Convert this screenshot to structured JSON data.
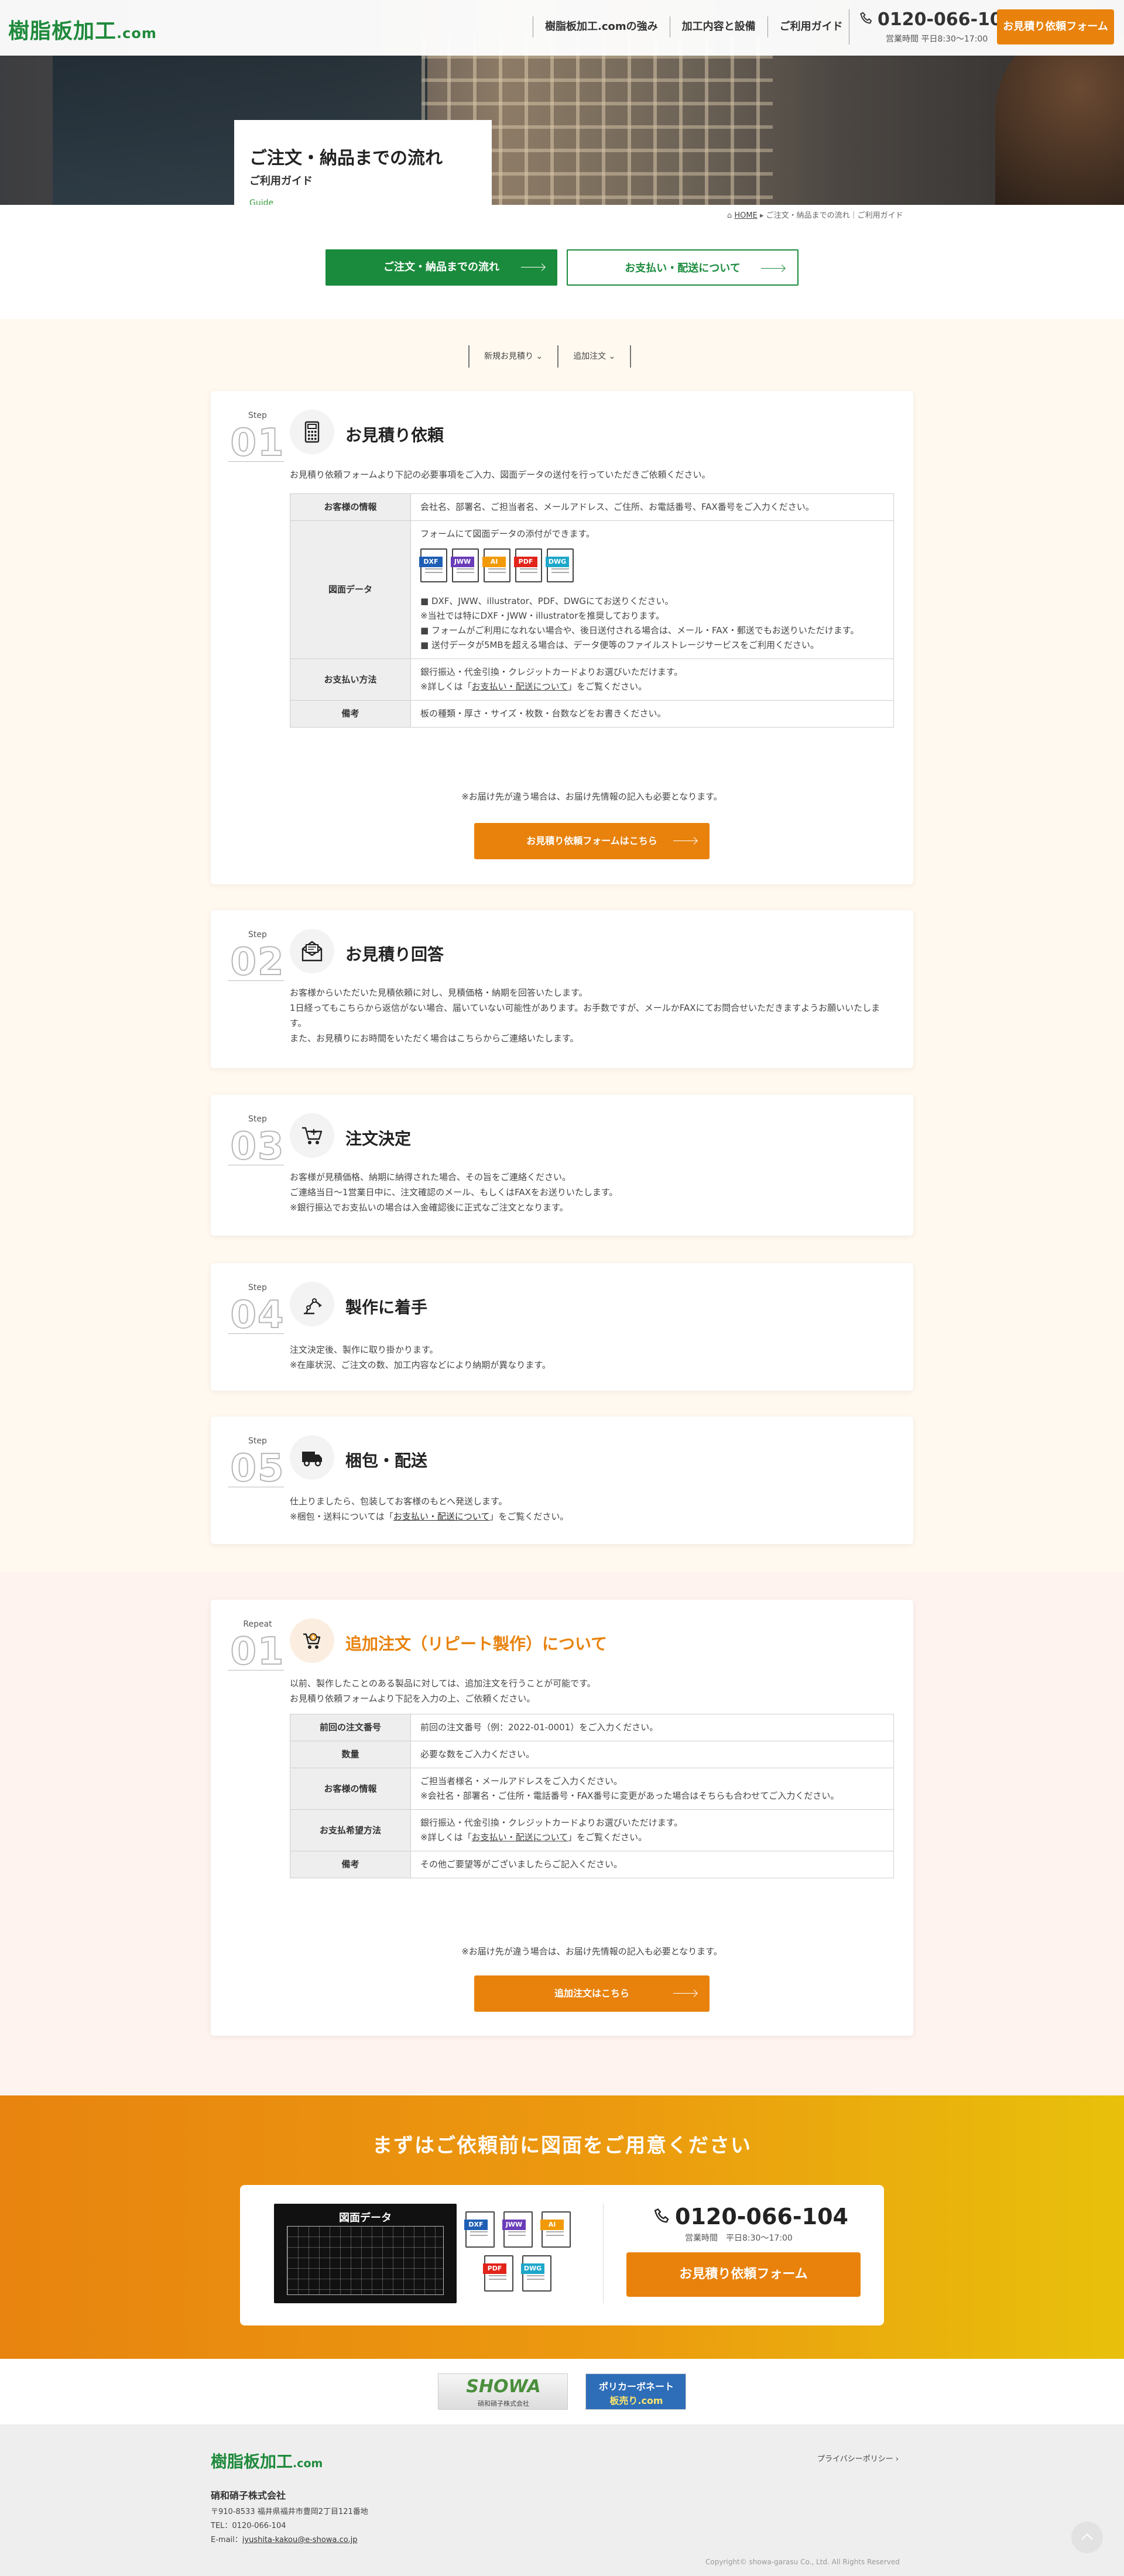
{
  "header": {
    "logo": "樹脂板加工",
    "logo_suffix": ".com",
    "nav": [
      "樹脂板加工.comの強み",
      "加工内容と設備",
      "ご利用ガイド"
    ],
    "tel": "0120-066-104",
    "hours": "営業時間 平日8:30～17:00",
    "button": "お見積り依頼フォーム"
  },
  "hero": {
    "title": "ご注文・納品までの流れ",
    "subtitle": "ご利用ガイド",
    "en": "Guide"
  },
  "breadcrumb": {
    "home": "HOME",
    "path": " ▸ ご注文・納品までの流れ｜ご利用ガイド"
  },
  "tabs": {
    "flow": "ご注文・納品までの流れ",
    "payment": "お支払い・配送について"
  },
  "anchors": [
    "新規お見積り ⌄",
    "追加注文 ⌄"
  ],
  "steps": [
    {
      "label": "Step",
      "num": "01",
      "title": "お見積り依頼",
      "icon": "calculator-icon",
      "text": "お見積り依頼フォームより下記の必要事項をご入力、図面データの送付を行っていただきご依頼ください。",
      "table": [
        {
          "th": "お客様の情報",
          "td": "会社名、部署名、ご担当者名、メールアドレス、ご住所、お電話番号、FAX番号をご入力ください。"
        },
        {
          "th": "図面データ",
          "td_intro": "フォームにて図面データの添付ができます。",
          "files": [
            "DXF",
            "JWW",
            "AI",
            "PDF",
            "DWG"
          ],
          "lines": [
            "■ DXF、JWW、illustrator、PDF、DWGにてお送りください。",
            "※当社では特にDXF・JWW・illustratorを推奨しております。",
            "■ フォームがご利用になれない場合や、後日送付される場合は、メール・FAX・郵送でもお送りいただけます。",
            "■ 送付データが5MBを超える場合は、データ便等のファイルストレージサービスをご利用ください。"
          ]
        },
        {
          "th": "お支払い方法",
          "td": "銀行振込・代金引換・クレジットカードよりお選びいただけます。",
          "td2_pre": "※詳しくは「",
          "td2_link": "お支払い・配送について",
          "td2_post": "」をご覧ください。"
        },
        {
          "th": "備考",
          "td": "板の種類・厚さ・サイズ・枚数・台数などをお書きください。"
        }
      ],
      "note": "※お届け先が違う場合は、お届け先情報の記入も必要となります。",
      "button": "お見積り依頼フォームはこちら"
    },
    {
      "label": "Step",
      "num": "02",
      "title": "お見積り回答",
      "icon": "mail-icon",
      "text": "お客様からいただいた見積依頼に対し、見積価格・納期を回答いたします。\n1日経ってもこちらから返信がない場合、届いていない可能性があります。お手数ですが、メールかFAXにてお問合せいただきますようお願いいたします。\nまた、お見積りにお時間をいただく場合はこちらからご連絡いたします。"
    },
    {
      "label": "Step",
      "num": "03",
      "title": "注文決定",
      "icon": "cart-icon",
      "text": "お客様が見積価格、納期に納得された場合、その旨をご連絡ください。\nご連絡当日～1営業日中に、注文確認のメール、もしくはFAXをお送りいたします。\n※銀行振込でお支払いの場合は入金確認後に正式なご注文となります。"
    },
    {
      "label": "Step",
      "num": "04",
      "title": "製作に着手",
      "icon": "robot-arm-icon",
      "text": "注文決定後、製作に取り掛かります。\n※在庫状況、ご注文の数、加工内容などにより納期が異なります。"
    },
    {
      "label": "Step",
      "num": "05",
      "title": "梱包・配送",
      "icon": "truck-icon",
      "text_pre": "仕上りましたら、包装してお客様のもとへ発送します。\n※梱包・送料については「",
      "text_link": "お支払い・配送について",
      "text_post": "」をご覧ください。"
    }
  ],
  "repeat": {
    "label": "Repeat",
    "num": "01",
    "title": "追加注文（リピート製作）について",
    "icon": "repeat-cart-icon",
    "text": "以前、製作したことのある製品に対しては、追加注文を行うことが可能です。\nお見積り依頼フォームより下記を入力の上、ご依頼ください。",
    "table": [
      {
        "th": "前回の注文番号",
        "td": "前回の注文番号（例：2022-01-0001）をご入力ください。"
      },
      {
        "th": "数量",
        "td": "必要な数をご入力ください。"
      },
      {
        "th": "お客様の情報",
        "td": "ご担当者様名・メールアドレスをご入力ください。",
        "td2": "※会社名・部署名・ご住所・電話番号・FAX番号に変更があった場合はそちらも合わせてご入力ください。"
      },
      {
        "th": "お支払希望方法",
        "td": "銀行振込・代金引換・クレジットカードよりお選びいただけます。",
        "td2_pre": "※詳しくは「",
        "td2_link": "お支払い・配送について",
        "td2_post": "」をご覧ください。"
      },
      {
        "th": "備考",
        "td": "その他ご要望等がございましたらご記入ください。"
      }
    ],
    "note": "※お届け先が違う場合は、お届け先情報の記入も必要となります。",
    "button": "追加注文はこちら"
  },
  "cta": {
    "title": "まずはご依頼前に図面をご用意ください",
    "drawing_label": "図面データ",
    "files": [
      "DXF",
      "JWW",
      "AI",
      "PDF",
      "DWG"
    ],
    "tel": "0120-066-104",
    "hours": "営業時間　平日8:30～17:00",
    "button": "お見積り依頼フォーム"
  },
  "banners": {
    "showa": "SHOWA",
    "showa_sub": "硝和硝子株式会社",
    "poly_1": "ポリカーボネート",
    "poly_2": "板売り.com"
  },
  "footer": {
    "logo": "樹脂板加工",
    "logo_suffix": ".com",
    "privacy": "プライバシーポリシー ›",
    "company": "硝和硝子株式会社",
    "address": "〒910-8533 福井県福井市豊岡2丁目121番地",
    "tel": "TEL：0120-066-104",
    "email_label": "E-mail：",
    "email": "iyushita-kakou@e-showa.co.jp",
    "copyright": "Copyright© showa-garasu Co., Ltd. All Rights Reserved"
  },
  "colors": {
    "green": "#1a8b3c",
    "orange": "#e8820c",
    "dxf": "#1e5fb4",
    "jww": "#6a3db8",
    "ai": "#f29a05",
    "pdf": "#e2241a",
    "dwg": "#1ea7c9"
  }
}
